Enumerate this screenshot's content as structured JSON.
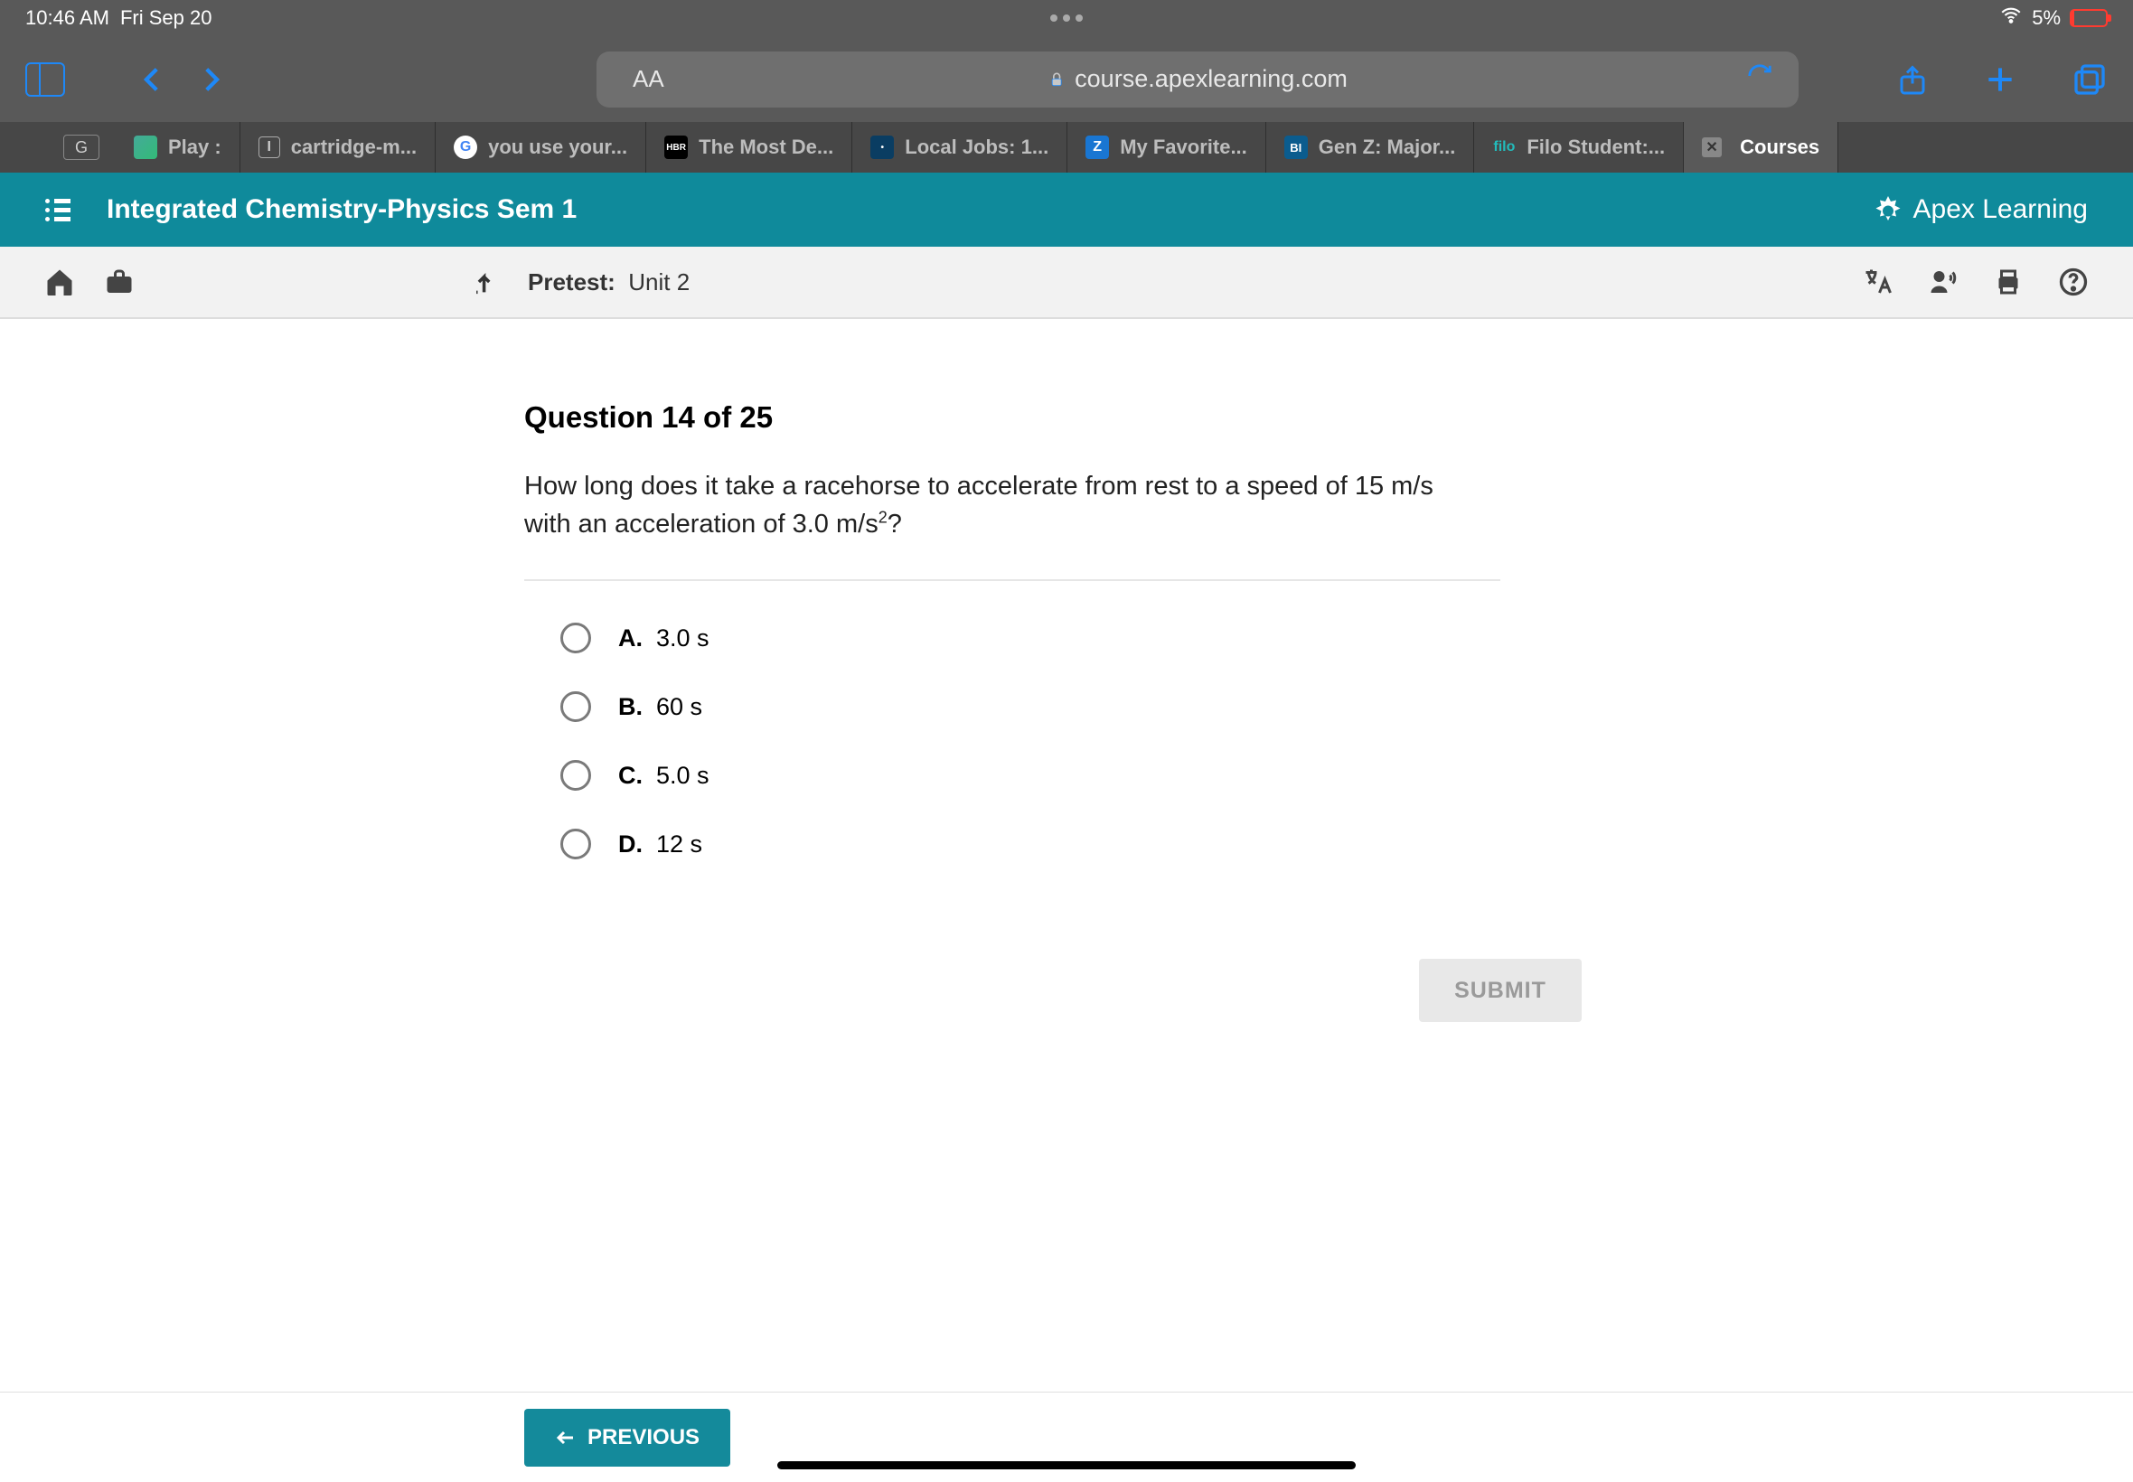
{
  "status": {
    "time": "10:46 AM",
    "date": "Fri Sep 20",
    "battery_pct": "5%"
  },
  "browser": {
    "aa_label": "AA",
    "url": "course.apexlearning.com",
    "tabs": [
      {
        "label": "Play :"
      },
      {
        "label": "cartridge-m..."
      },
      {
        "label": "you use your..."
      },
      {
        "label": "The Most De..."
      },
      {
        "label": "Local Jobs: 1..."
      },
      {
        "label": "My Favorite..."
      },
      {
        "label": "Gen Z: Major..."
      },
      {
        "label": "Filo Student:..."
      },
      {
        "label": "Courses"
      }
    ]
  },
  "apex": {
    "course_title": "Integrated Chemistry-Physics Sem 1",
    "brand": "Apex Learning"
  },
  "subbar": {
    "pretest_bold": "Pretest:",
    "pretest_unit": "Unit 2"
  },
  "question": {
    "header": "Question 14 of 25",
    "text_1": "How long does it take a racehorse to accelerate from rest to a speed of 15 m/s with an acceleration of 3.0 m/s",
    "text_sup": "2",
    "text_2": "?",
    "options": [
      {
        "letter": "A.",
        "text": "3.0 s"
      },
      {
        "letter": "B.",
        "text": "60 s"
      },
      {
        "letter": "C.",
        "text": "5.0 s"
      },
      {
        "letter": "D.",
        "text": "12 s"
      }
    ],
    "submit": "SUBMIT",
    "previous": "PREVIOUS"
  }
}
